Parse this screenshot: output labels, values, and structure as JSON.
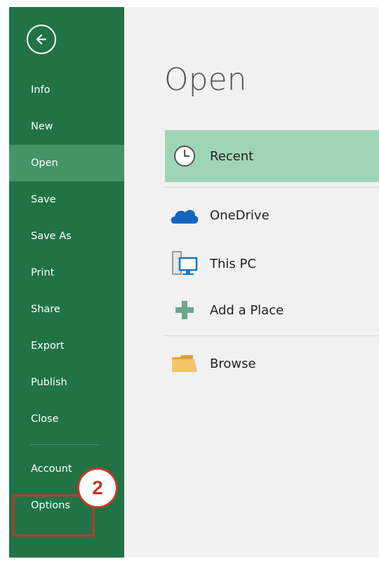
{
  "backstage": {
    "back_icon": "back-arrow-icon",
    "nav": [
      {
        "label": "Info"
      },
      {
        "label": "New"
      },
      {
        "label": "Open",
        "active": true
      },
      {
        "label": "Save"
      },
      {
        "label": "Save As"
      },
      {
        "label": "Print"
      },
      {
        "label": "Share"
      },
      {
        "label": "Export"
      },
      {
        "label": "Publish"
      },
      {
        "label": "Close"
      }
    ],
    "bottom_nav": [
      {
        "label": "Account"
      },
      {
        "label": "Options"
      }
    ]
  },
  "annotation": {
    "step_badge": "2",
    "color": "#c0392b"
  },
  "main": {
    "title": "Open",
    "locations": [
      {
        "label": "Recent",
        "icon": "clock-icon",
        "selected": true
      },
      {
        "label": "OneDrive",
        "icon": "cloud-icon"
      },
      {
        "label": "This PC",
        "icon": "computer-icon"
      },
      {
        "label": "Add a Place",
        "icon": "plus-icon"
      },
      {
        "label": "Browse",
        "icon": "folder-icon"
      }
    ]
  },
  "colors": {
    "sidebar": "#217346",
    "sidebar_active": "#439467",
    "selected_row": "#9fd5b7",
    "content_bg": "#f1f1f1"
  }
}
